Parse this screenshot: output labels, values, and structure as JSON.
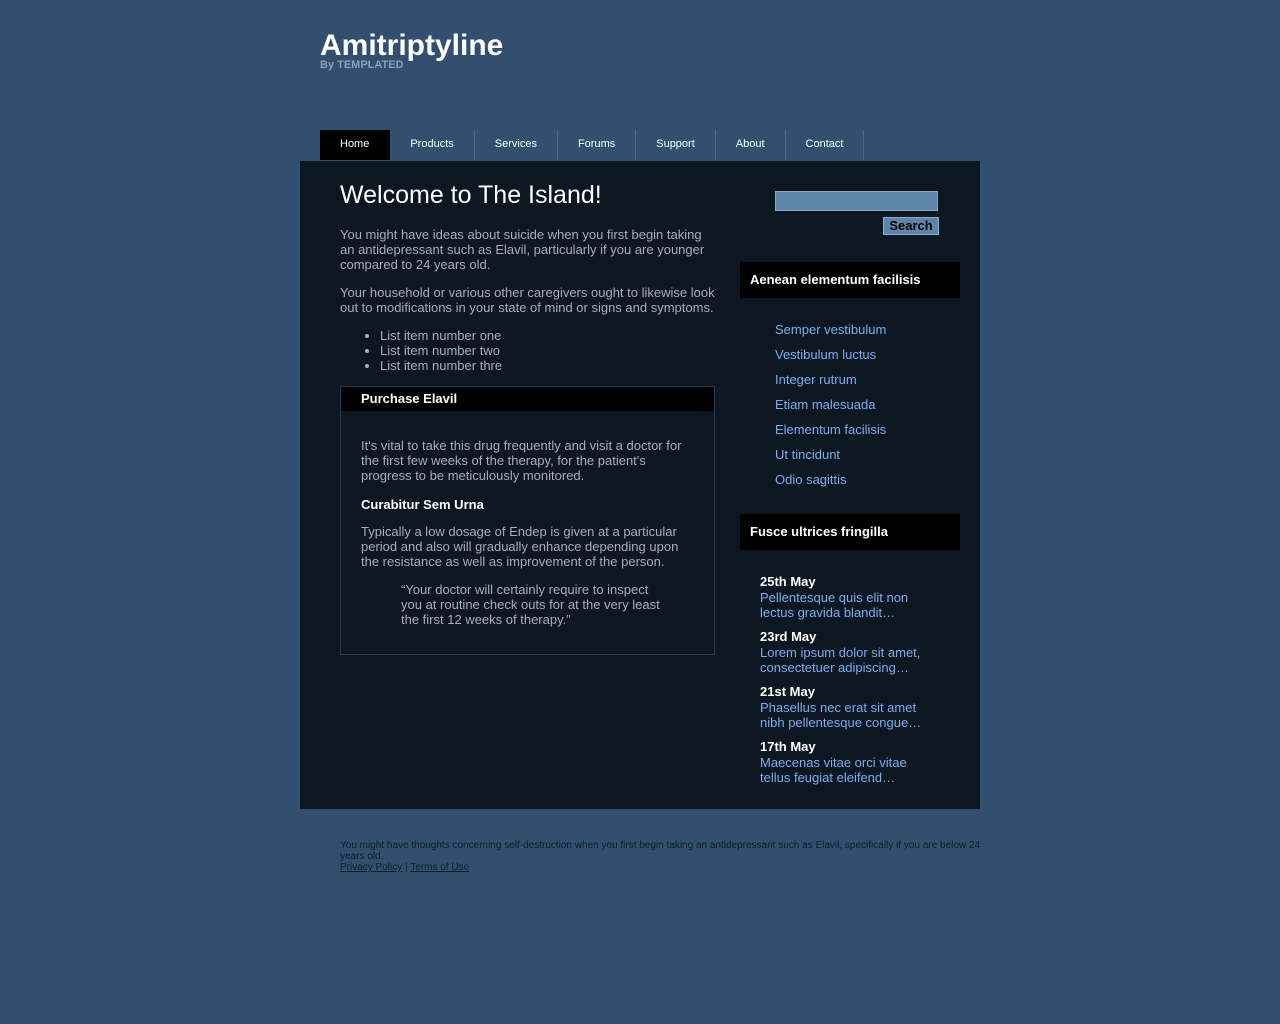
{
  "header": {
    "title": "Amitriptyline",
    "subtitle": "By TEMPLATED"
  },
  "menu": {
    "items": [
      {
        "label": "Home",
        "active": true
      },
      {
        "label": "Products"
      },
      {
        "label": "Services"
      },
      {
        "label": "Forums"
      },
      {
        "label": "Support"
      },
      {
        "label": "About"
      },
      {
        "label": "Contact"
      }
    ]
  },
  "content": {
    "title": "Welcome to The Island!",
    "p1": "You might have ideas about suicide when you first begin taking an antidepressant such as Elavil, particularly if you are younger compared to 24 years old.",
    "p2": "Your household or various other caregivers ought to likewise look out to modifications in your state of mind or signs and symptoms.",
    "list": [
      "List item number one",
      "List item number two",
      "List item number thre"
    ],
    "box": {
      "title": "Purchase Elavil",
      "p1": "It's vital to take this drug frequently and visit a doctor for the first few weeks of the therapy, for the patient's progress to be meticulously monitored.",
      "subheading": "Curabitur Sem Urna",
      "p2": "Typically a low dosage of Endep is given at a particular period and also will gradually enhance depending upon the resistance as well as improvement of the person.",
      "quote": "“Your doctor will certainly require to inspect you at routine check outs for at the very least the first 12 weeks of therapy.”"
    }
  },
  "sidebar": {
    "search": {
      "value": "",
      "button_label": "Search"
    },
    "links_heading": "Aenean elementum facilisis",
    "links": [
      "Semper vestibulum",
      "Vestibulum luctus",
      "Integer rutrum",
      "Etiam malesuada",
      "Elementum facilisis",
      "Ut tincidunt",
      "Odio sagittis"
    ],
    "news_heading": "Fusce ultrices fringilla",
    "news": [
      {
        "date": "25th May",
        "text": "Pellentesque quis elit non lectus gravida blandit…"
      },
      {
        "date": "23rd May",
        "text": "Lorem ipsum dolor sit amet, consectetuer adipiscing…"
      },
      {
        "date": "21st May",
        "text": "Phasellus nec erat sit amet nibh pellentesque congue…"
      },
      {
        "date": "17th May",
        "text": "Maecenas vitae orci vitae tellus feugiat eleifend…"
      }
    ]
  },
  "footer": {
    "text": "You might have thoughts concerning self-destruction when you first begin taking an antidepressant such as Elavil, specifically if you are below 24 years old.",
    "privacy": "Privacy Policy",
    "separator": "|",
    "terms": "Terms of Use"
  },
  "colors": {
    "page_bg": "#324f6f",
    "panel_bg": "#0d1722",
    "link": "#79aef0"
  }
}
